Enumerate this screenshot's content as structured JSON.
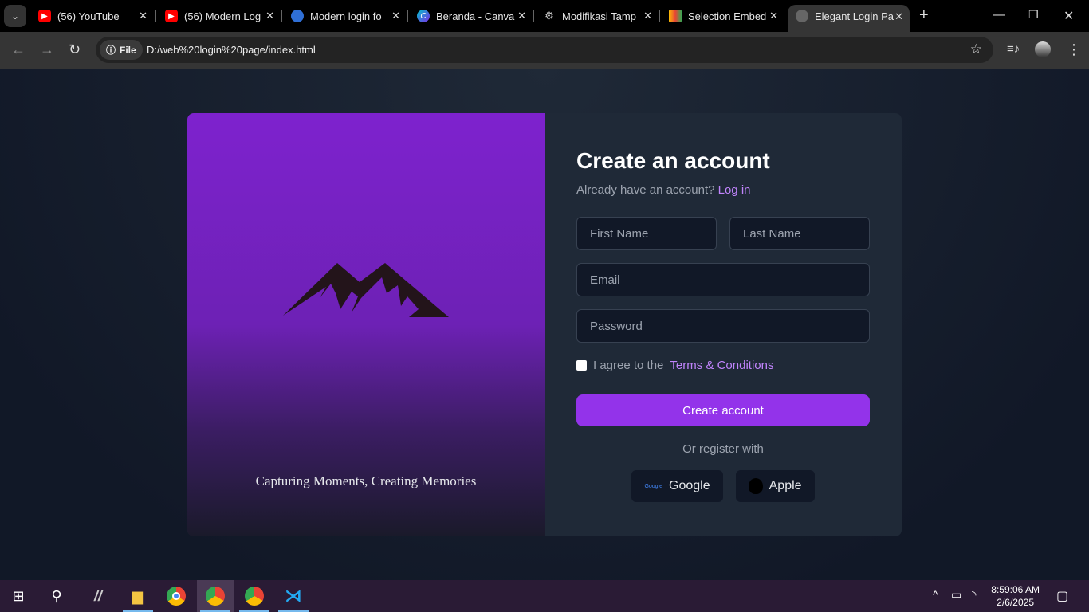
{
  "browser": {
    "tabs": [
      {
        "title": "(56) YouTube",
        "icon": "youtube-icon"
      },
      {
        "title": "(56) Modern Log",
        "icon": "youtube-icon"
      },
      {
        "title": "Modern login fo",
        "icon": "bing-icon"
      },
      {
        "title": "Beranda - Canva",
        "icon": "canva-icon"
      },
      {
        "title": "Modifikasi Tamp",
        "icon": "chatgpt-icon"
      },
      {
        "title": "Selection Embed",
        "icon": "app-icon"
      },
      {
        "title": "Elegant Login Pa",
        "icon": "globe-icon",
        "active": true
      }
    ],
    "new_tab": "+",
    "chip": "File",
    "url": "D:/web%20login%20page/index.html"
  },
  "left_panel": {
    "tagline": "Capturing Moments, Creating Memories"
  },
  "form": {
    "title": "Create an account",
    "subtitle": "Already have an account?",
    "login_link": "Log in",
    "first_name_placeholder": "First Name",
    "last_name_placeholder": "Last Name",
    "email_placeholder": "Email",
    "password_placeholder": "Password",
    "agree_text": "I agree to the",
    "terms_link": "Terms & Conditions",
    "submit": "Create account",
    "or_text": "Or register with",
    "google": "Google",
    "apple": "Apple",
    "accent": "#9333ea"
  },
  "taskbar": {
    "time": "8:59:06 AM",
    "date": "2/6/2025"
  }
}
